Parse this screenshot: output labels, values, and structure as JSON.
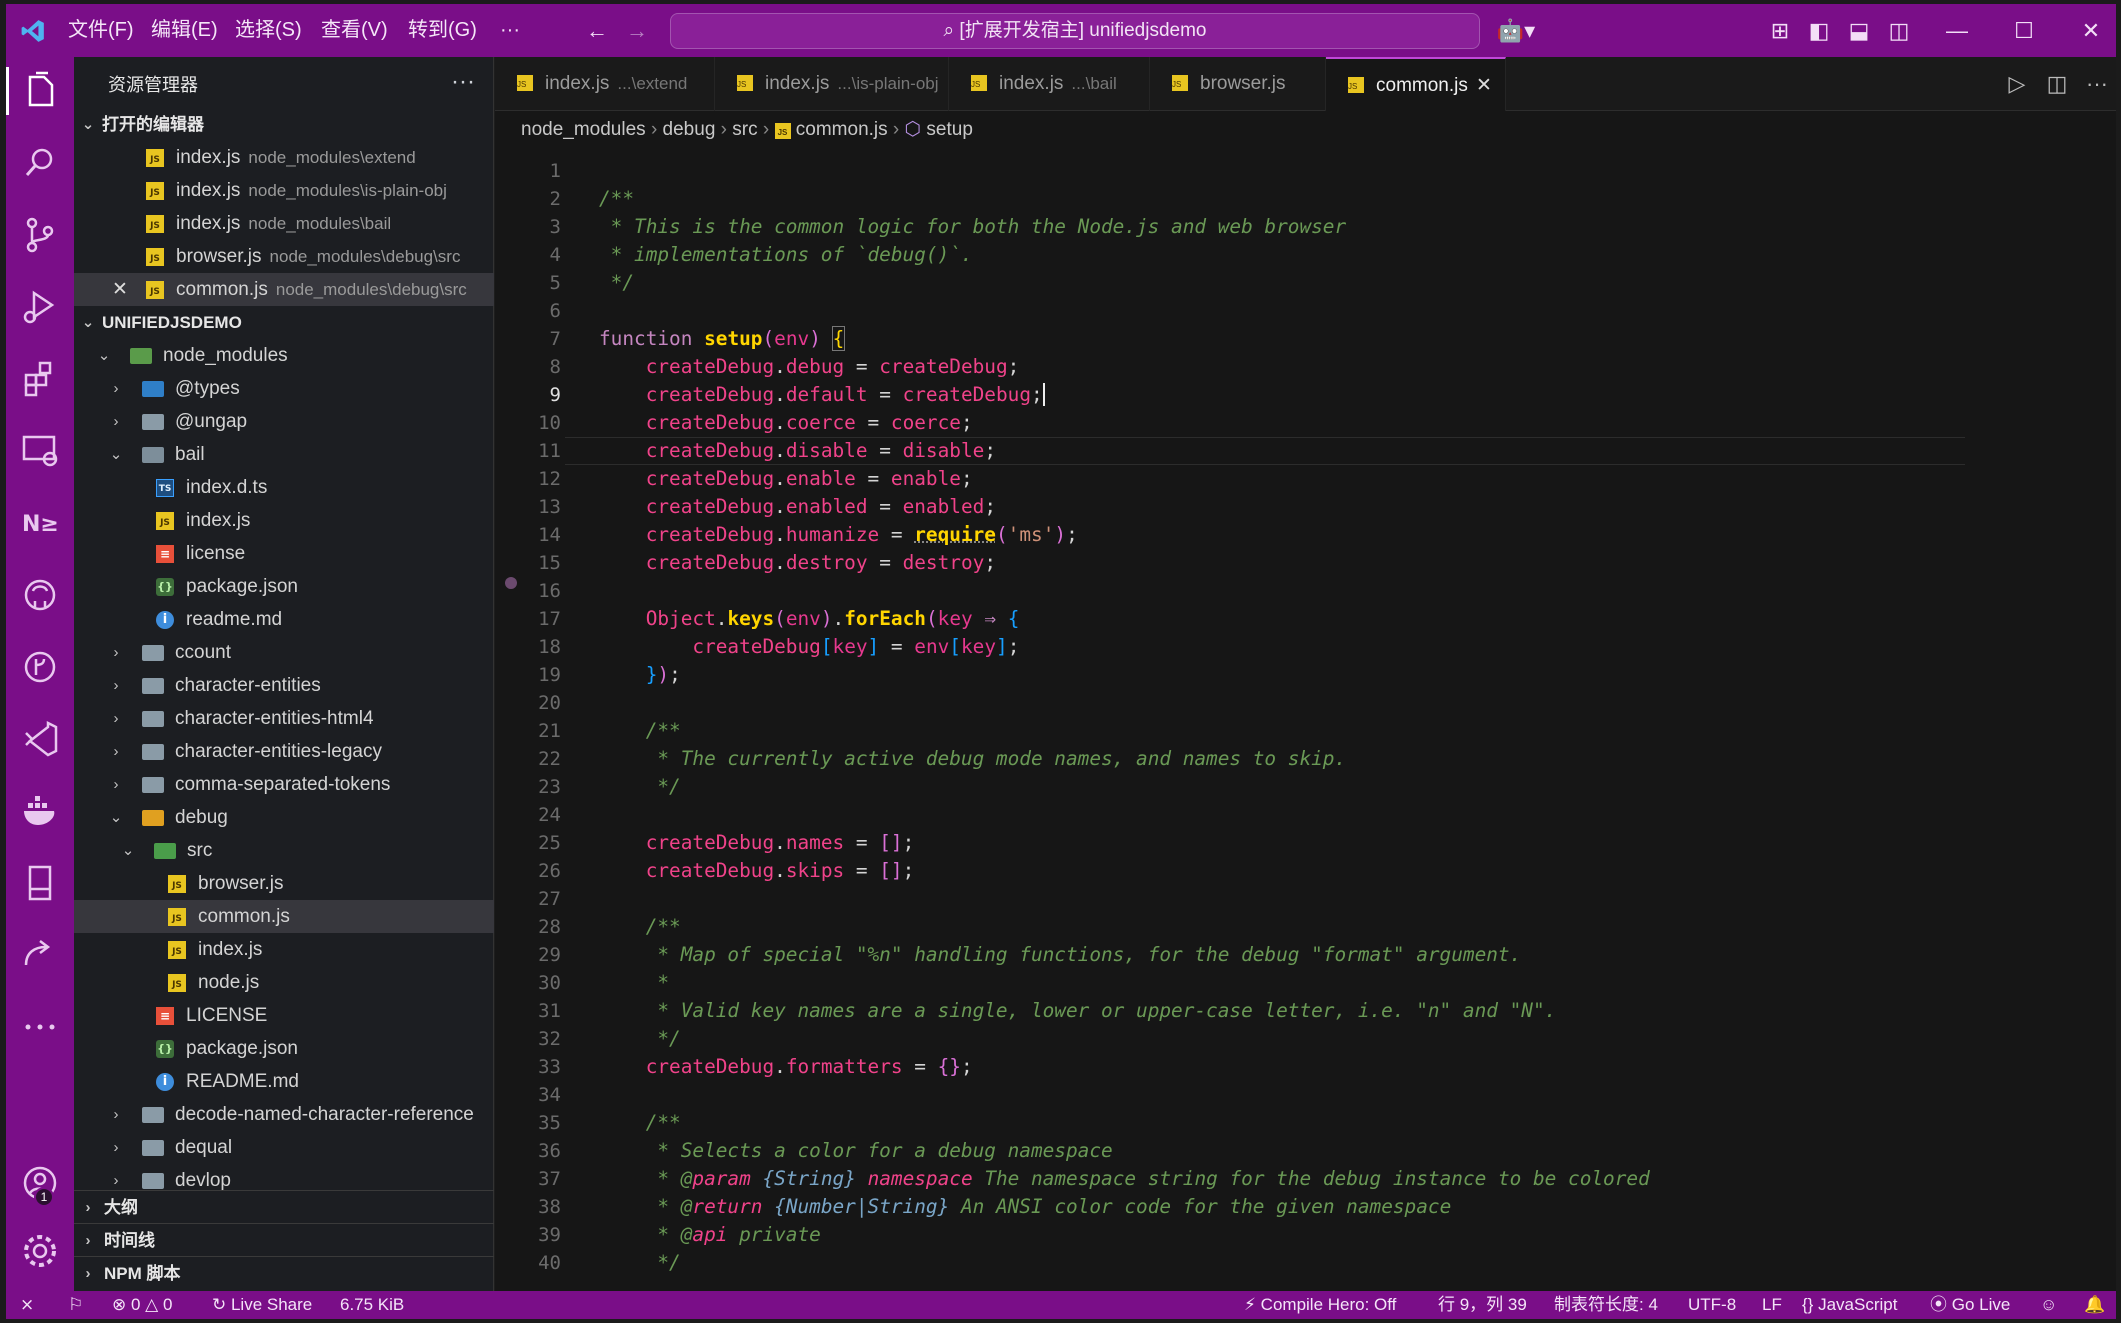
{
  "titlebar": {
    "menus": [
      "文件(F)",
      "编辑(E)",
      "选择(S)",
      "查看(V)",
      "转到(G)",
      "···"
    ],
    "command_center": "[扩展开发宿主] unifiedjsdemo"
  },
  "sidebar": {
    "title": "资源管理器",
    "open_editors_title": "打开的编辑器",
    "open_editors": [
      {
        "name": "index.js",
        "path": "node_modules\\extend"
      },
      {
        "name": "index.js",
        "path": "node_modules\\is-plain-obj"
      },
      {
        "name": "index.js",
        "path": "node_modules\\bail"
      },
      {
        "name": "browser.js",
        "path": "node_modules\\debug\\src"
      },
      {
        "name": "common.js",
        "path": "node_modules\\debug\\src"
      }
    ],
    "workspace_title": "UNIFIEDJSDEMO",
    "tree": [
      "node_modules",
      "@types",
      "@ungap",
      "bail",
      "index.d.ts",
      "index.js",
      "license",
      "package.json",
      "readme.md",
      "ccount",
      "character-entities",
      "character-entities-html4",
      "character-entities-legacy",
      "comma-separated-tokens",
      "debug",
      "src",
      "browser.js",
      "common.js",
      "index.js",
      "node.js",
      "LICENSE",
      "package.json",
      "README.md",
      "decode-named-character-reference",
      "dequal",
      "devlop"
    ],
    "bottom_sections": [
      "大纲",
      "时间线",
      "NPM 脚本"
    ]
  },
  "tabs": [
    {
      "name": "index.js",
      "desc": "...\\extend"
    },
    {
      "name": "index.js",
      "desc": "...\\is-plain-obj"
    },
    {
      "name": "index.js",
      "desc": "...\\bail"
    },
    {
      "name": "browser.js",
      "desc": ""
    },
    {
      "name": "common.js",
      "desc": ""
    }
  ],
  "breadcrumb": [
    "node_modules",
    "debug",
    "src",
    "common.js",
    "setup"
  ],
  "editor": {
    "current_line": 9,
    "line_numbers": [
      "1",
      "2",
      "3",
      "4",
      "5",
      "6",
      "7",
      "8",
      "9",
      "10",
      "11",
      "12",
      "13",
      "14",
      "15",
      "16",
      "17",
      "18",
      "19",
      "20",
      "21",
      "22",
      "23",
      "24",
      "25",
      "26",
      "27",
      "28",
      "29",
      "30",
      "31",
      "32",
      "33",
      "34",
      "35",
      "36",
      "37",
      "38",
      "39",
      "40"
    ],
    "code": {
      "l2": "/**",
      "l3": " * This is the common logic for both the Node.js and web browser",
      "l4": " * implementations of `debug()`.",
      "l5": " */",
      "l7a": "function",
      "l7b": "setup",
      "l7c": "env",
      "l8a": "createDebug",
      "l8b": "debug",
      "l8c": "createDebug",
      "l9a": "createDebug",
      "l9b": "default",
      "l9c": "createDebug",
      "l10a": "createDebug",
      "l10b": "coerce",
      "l10c": "coerce",
      "l11a": "createDebug",
      "l11b": "disable",
      "l11c": "disable",
      "l12a": "createDebug",
      "l12b": "enable",
      "l12c": "enable",
      "l13a": "createDebug",
      "l13b": "enabled",
      "l13c": "enabled",
      "l14a": "createDebug",
      "l14b": "humanize",
      "l14c": "require",
      "l14d": "'ms'",
      "l15a": "createDebug",
      "l15b": "destroy",
      "l15c": "destroy",
      "l17a": "Object",
      "l17b": "keys",
      "l17c": "env",
      "l17d": "forEach",
      "l17e": "key",
      "l18a": "createDebug",
      "l18b": "key",
      "l18c": "env",
      "l18d": "key",
      "l21": "/**",
      "l22": " * The currently active debug mode names, and names to skip.",
      "l23": " */",
      "l25a": "createDebug",
      "l25b": "names",
      "l26a": "createDebug",
      "l26b": "skips",
      "l28": "/**",
      "l29": " * Map of special \"%n\" handling functions, for the debug \"format\" argument.",
      "l30": " *",
      "l31": " * Valid key names are a single, lower or upper-case letter, i.e. \"n\" and \"N\".",
      "l32": " */",
      "l33a": "createDebug",
      "l33b": "formatters",
      "l35": "/**",
      "l36": " * Selects a color for a debug namespace",
      "l37a": " * @",
      "l37b": "param",
      "l37c": "{String}",
      "l37d": "namespace",
      "l37e": " The namespace string for the debug instance to be colored",
      "l38a": " * @",
      "l38b": "return",
      "l38c": "{Number|String}",
      "l38d": " An ANSI color code for the given namespace",
      "l39a": " * @",
      "l39b": "api",
      "l39c": " private",
      "l40": " */"
    }
  },
  "statusbar": {
    "problems": "0",
    "warnings": "0",
    "live_share": "Live Share",
    "file_size": "6.75 KiB",
    "compile_hero": "Compile Hero: Off",
    "cursor": "行 9，列 39",
    "tab_size": "制表符长度: 4",
    "encoding": "UTF-8",
    "eol": "LF",
    "language": "JavaScript",
    "go_live": "Go Live"
  },
  "accounts_badge": "1",
  "colors": {
    "accent": "#7a0e88",
    "editor_bg": "#161616",
    "sidebar_bg": "#1c1e22"
  }
}
